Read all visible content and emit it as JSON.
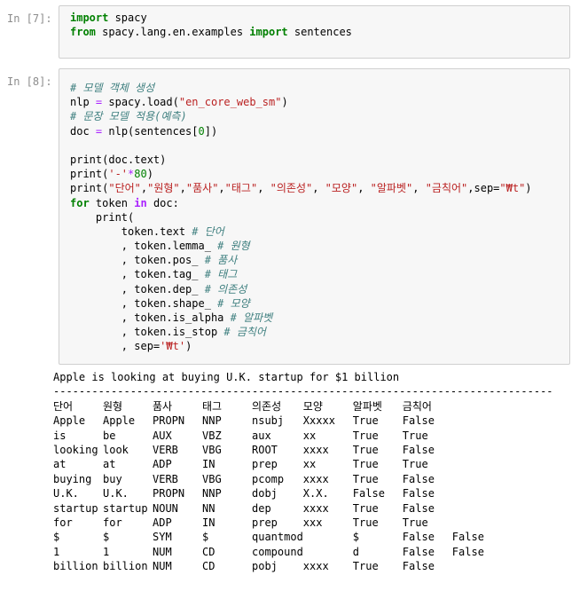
{
  "cells": [
    {
      "prompt": "In [7]:",
      "lines": [
        [
          {
            "t": "kw",
            "v": "import"
          },
          {
            "t": "",
            "v": " spacy"
          }
        ],
        [
          {
            "t": "kw",
            "v": "from"
          },
          {
            "t": "",
            "v": " spacy.lang.en.examples "
          },
          {
            "t": "kw",
            "v": "import"
          },
          {
            "t": "",
            "v": " sentences"
          }
        ]
      ]
    },
    {
      "prompt": "In [8]:",
      "lines": [
        [
          {
            "t": "cm",
            "v": "# 모델 객체 생성"
          }
        ],
        [
          {
            "t": "",
            "v": "nlp "
          },
          {
            "t": "op",
            "v": "="
          },
          {
            "t": "",
            "v": " spacy.load("
          },
          {
            "t": "st",
            "v": "\"en_core_web_sm\""
          },
          {
            "t": "",
            "v": ")"
          }
        ],
        [
          {
            "t": "cm",
            "v": "# 문장 모델 적용(예측)"
          }
        ],
        [
          {
            "t": "",
            "v": "doc "
          },
          {
            "t": "op",
            "v": "="
          },
          {
            "t": "",
            "v": " nlp(sentences["
          },
          {
            "t": "nu",
            "v": "0"
          },
          {
            "t": "",
            "v": "])"
          }
        ],
        [
          {
            "t": "",
            "v": ""
          }
        ],
        [
          {
            "t": "",
            "v": "print(doc.text)"
          }
        ],
        [
          {
            "t": "",
            "v": "print("
          },
          {
            "t": "st",
            "v": "'-'"
          },
          {
            "t": "op",
            "v": "*"
          },
          {
            "t": "nu",
            "v": "80"
          },
          {
            "t": "",
            "v": ")"
          }
        ],
        [
          {
            "t": "",
            "v": "print("
          },
          {
            "t": "st",
            "v": "\"단어\""
          },
          {
            "t": "",
            "v": ","
          },
          {
            "t": "st",
            "v": "\"원형\""
          },
          {
            "t": "",
            "v": ","
          },
          {
            "t": "st",
            "v": "\"품사\""
          },
          {
            "t": "",
            "v": ","
          },
          {
            "t": "st",
            "v": "\"태그\""
          },
          {
            "t": "",
            "v": ", "
          },
          {
            "t": "st",
            "v": "\"의존성\""
          },
          {
            "t": "",
            "v": ", "
          },
          {
            "t": "st",
            "v": "\"모양\""
          },
          {
            "t": "",
            "v": ", "
          },
          {
            "t": "st",
            "v": "\"알파벳\""
          },
          {
            "t": "",
            "v": ", "
          },
          {
            "t": "st",
            "v": "\"금칙어\""
          },
          {
            "t": "",
            "v": ",sep="
          },
          {
            "t": "st",
            "v": "\"₩t\""
          },
          {
            "t": "",
            "v": ")"
          }
        ],
        [
          {
            "t": "kw",
            "v": "for"
          },
          {
            "t": "",
            "v": " token "
          },
          {
            "t": "kw2",
            "v": "in"
          },
          {
            "t": "",
            "v": " doc:"
          }
        ],
        [
          {
            "t": "",
            "v": "    print("
          }
        ],
        [
          {
            "t": "",
            "v": "        token.text "
          },
          {
            "t": "cm",
            "v": "# 단어"
          }
        ],
        [
          {
            "t": "",
            "v": "        , token.lemma_ "
          },
          {
            "t": "cm",
            "v": "# 원형"
          }
        ],
        [
          {
            "t": "",
            "v": "        , token.pos_ "
          },
          {
            "t": "cm",
            "v": "# 품사"
          }
        ],
        [
          {
            "t": "",
            "v": "        , token.tag_ "
          },
          {
            "t": "cm",
            "v": "# 태그"
          }
        ],
        [
          {
            "t": "",
            "v": "        , token.dep_ "
          },
          {
            "t": "cm",
            "v": "# 의존성"
          }
        ],
        [
          {
            "t": "",
            "v": "        , token.shape_ "
          },
          {
            "t": "cm",
            "v": "# 모양"
          }
        ],
        [
          {
            "t": "",
            "v": "        , token.is_alpha "
          },
          {
            "t": "cm",
            "v": "# 알파벳"
          }
        ],
        [
          {
            "t": "",
            "v": "        , token.is_stop "
          },
          {
            "t": "cm",
            "v": "# 금칙어"
          }
        ],
        [
          {
            "t": "",
            "v": "        , sep="
          },
          {
            "t": "st",
            "v": "'₩t'"
          },
          {
            "t": "",
            "v": ")"
          }
        ]
      ]
    }
  ],
  "output": {
    "title": "Apple is looking at buying U.K. startup for $1 billion",
    "separator": "--------------------------------------------------------------------------------",
    "header": [
      "단어",
      "원형",
      "품사",
      "태그",
      "의존성",
      "모양",
      "알파벳",
      "금칙어"
    ],
    "rows": [
      [
        "Apple",
        "Apple",
        "PROPN",
        "NNP",
        "nsubj",
        "Xxxxx",
        "True",
        "False"
      ],
      [
        "is",
        "be",
        "AUX",
        "VBZ",
        "aux",
        "xx",
        "True",
        "True"
      ],
      [
        "looking",
        "look",
        "VERB",
        "VBG",
        "ROOT",
        "xxxx",
        "True",
        "False"
      ],
      [
        "at",
        "at",
        "ADP",
        "IN",
        "prep",
        "xx",
        "True",
        "True"
      ],
      [
        "buying",
        "buy",
        "VERB",
        "VBG",
        "pcomp",
        "xxxx",
        "True",
        "False"
      ],
      [
        "U.K.",
        "U.K.",
        "PROPN",
        "NNP",
        "dobj",
        "X.X.",
        "False",
        "False"
      ],
      [
        "startup",
        "startup",
        "NOUN",
        "NN",
        "dep",
        "xxxx",
        "True",
        "False"
      ],
      [
        "for",
        "for",
        "ADP",
        "IN",
        "prep",
        "xxx",
        "True",
        "True"
      ],
      [
        "$",
        "$",
        "SYM",
        "$",
        "quantmod",
        "",
        "$",
        "False",
        "False"
      ],
      [
        "1",
        "1",
        "NUM",
        "CD",
        "compound",
        "",
        "d",
        "False",
        "False"
      ],
      [
        "billion",
        "billion",
        "NUM",
        "CD",
        "pobj",
        "xxxx",
        "True",
        "False"
      ]
    ]
  }
}
